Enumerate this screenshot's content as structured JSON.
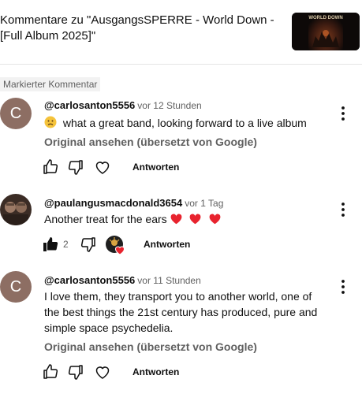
{
  "header": {
    "title": "Kommentare zu \"AusgangsSPERRE - World Down - [Full Album 2025]\"",
    "thumbnail_title": "WORLD DOWN"
  },
  "pinned_label": "Markierter Kommentar",
  "comments": [
    {
      "author": "@carlosanton5556",
      "time": "vor 12 Stunden",
      "avatar_letter": "C",
      "text": "what a great band, looking forward to a live album",
      "translate": "Original ansehen (übersetzt von Google)",
      "reply": "Antworten"
    },
    {
      "author": "@paulangusmacdonald3654",
      "time": "vor 1 Tag",
      "text": "Another treat for the ears",
      "likes": "2",
      "reply": "Antworten"
    },
    {
      "author": "@carlosanton5556",
      "time": "vor 11 Stunden",
      "avatar_letter": "C",
      "text": "I love them, they transport you to another world, one of the best things the 21st century has produced, pure and simple space psychedelia.",
      "translate": "Original ansehen (übersetzt von Google)",
      "reply": "Antworten"
    }
  ],
  "colors": {
    "avatar_bg": "#8d6e63",
    "muted_text": "#606060",
    "heart_red": "#e8232e"
  },
  "icons": [
    "sad-face-emoji-icon",
    "thumb-up-icon",
    "thumb-down-icon",
    "heart-icon",
    "more-vert-icon",
    "red-heart-emoji-icon",
    "creator-heart-badge-icon"
  ]
}
